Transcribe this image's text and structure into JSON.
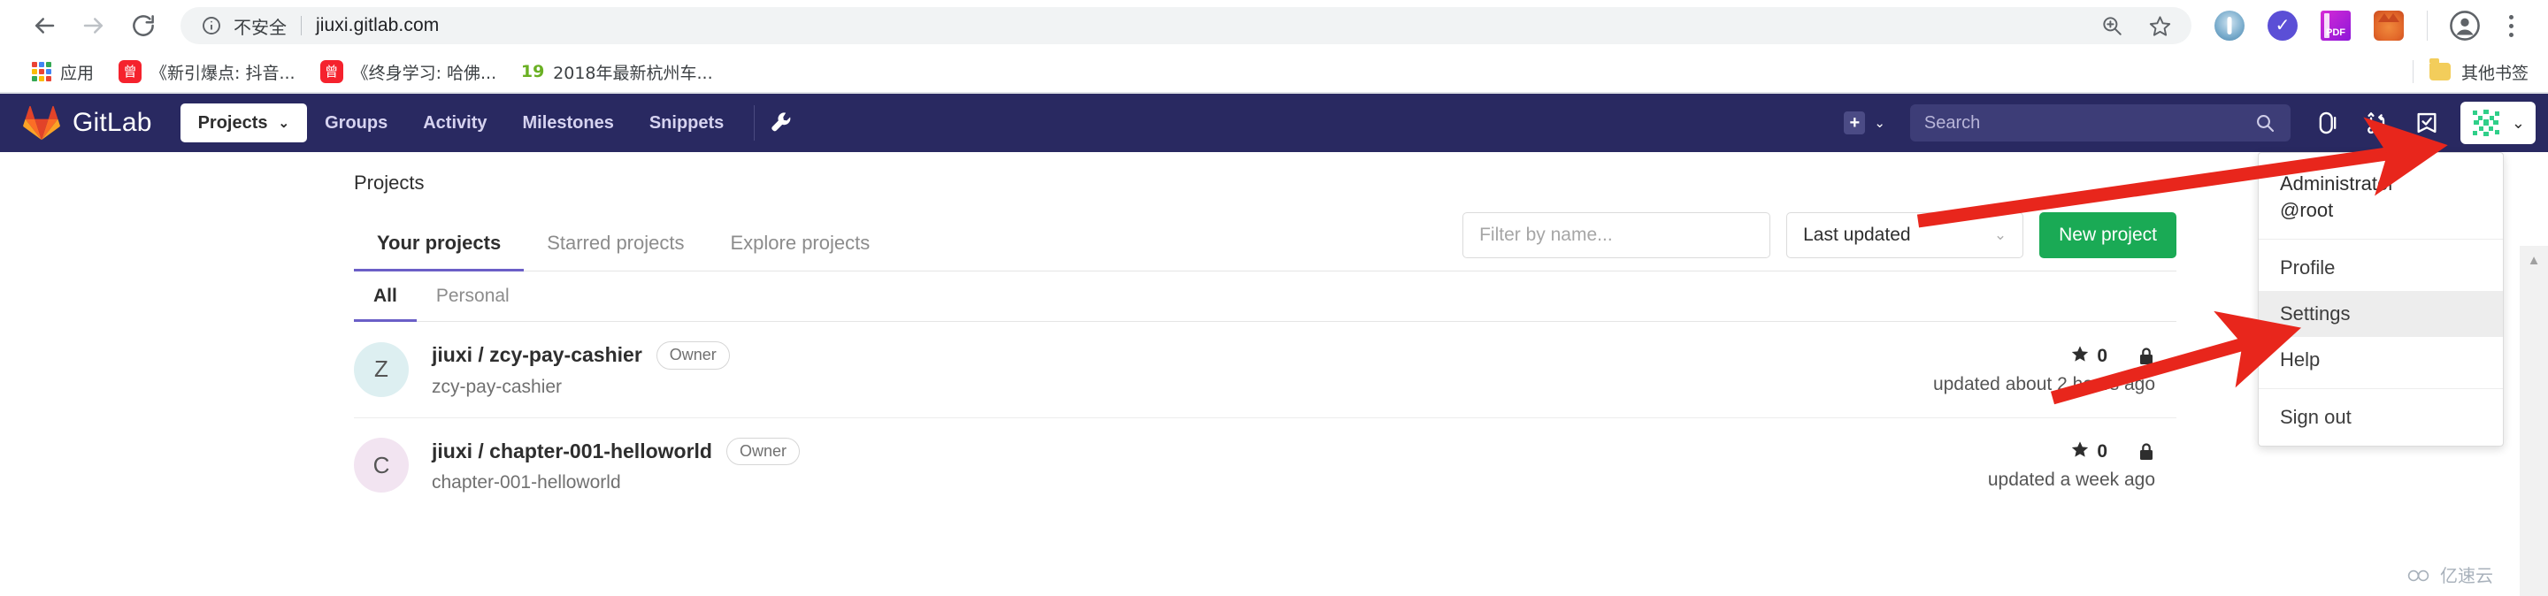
{
  "browser": {
    "nav": {
      "back_icon": "arrow-left-icon",
      "forward_icon": "arrow-right-icon",
      "reload_icon": "reload-icon"
    },
    "omnibox": {
      "info_icon": "info-circle-icon",
      "security_label": "不安全",
      "url": "jiuxi.gitlab.com",
      "zoom_icon": "zoom-in-icon",
      "bookmark_icon": "star-icon"
    },
    "extensions": [
      {
        "name": "brave-extension-icon",
        "title": ""
      },
      {
        "name": "verified-badge-extension-icon",
        "title": ""
      },
      {
        "name": "pdf-extension-icon",
        "title": "PDF"
      },
      {
        "name": "metamask-fox-extension-icon",
        "title": ""
      }
    ],
    "profile_icon": "account-circle-icon",
    "menu_icon": "three-dot-menu-icon",
    "bookmarks": [
      {
        "icon": "apps-grid-icon",
        "label": "应用"
      },
      {
        "icon": "red-square-icon",
        "label": "《新引爆点: 抖音..."
      },
      {
        "icon": "red-square-icon",
        "label": "《终身学习: 哈佛..."
      },
      {
        "icon": "green-19-icon",
        "label": "2018年最新杭州车..."
      }
    ],
    "other_bookmarks": {
      "icon": "folder-icon",
      "label": "其他书签"
    }
  },
  "gitlab": {
    "brand": "GitLab",
    "logo_icon": "gitlab-tanuki-logo",
    "nav_links": [
      {
        "label": "Projects",
        "active": true,
        "chevron": "⌄"
      },
      {
        "label": "Groups",
        "active": false
      },
      {
        "label": "Activity",
        "active": false
      },
      {
        "label": "Milestones",
        "active": false
      },
      {
        "label": "Snippets",
        "active": false
      }
    ],
    "admin_icon": "wrench-icon",
    "plus": {
      "icon": "plus-square-icon",
      "chevron": "⌄"
    },
    "search": {
      "placeholder": "Search",
      "icon": "search-icon"
    },
    "right_icons": [
      {
        "name": "issues-icon"
      },
      {
        "name": "merge-requests-icon"
      },
      {
        "name": "todos-icon"
      }
    ],
    "user": {
      "avatar_icon": "identicon-avatar",
      "chevron": "⌄"
    }
  },
  "dropdown": {
    "name": "Administrator",
    "handle": "@root",
    "items": [
      {
        "label": "Profile",
        "highlighted": false
      },
      {
        "label": "Settings",
        "highlighted": true
      },
      {
        "label": "Help",
        "highlighted": false
      },
      {
        "label": "Sign out",
        "highlighted": false
      }
    ]
  },
  "main": {
    "breadcrumb": "Projects",
    "tabs": [
      {
        "label": "Your projects",
        "active": true
      },
      {
        "label": "Starred projects",
        "active": false
      },
      {
        "label": "Explore projects",
        "active": false
      }
    ],
    "filter": {
      "placeholder": "Filter by name...",
      "value": ""
    },
    "sort": {
      "value": "Last updated",
      "chevron": "⌄"
    },
    "new_project_label": "New project",
    "subtabs": [
      {
        "label": "All",
        "active": true
      },
      {
        "label": "Personal",
        "active": false
      }
    ],
    "projects": [
      {
        "avatar_letter": "Z",
        "avatar_color": "#ddeff1",
        "title": "jiuxi / zcy-pay-cashier",
        "badge": "Owner",
        "description": "zcy-pay-cashier",
        "stars": "0",
        "star_icon": "star-filled-icon",
        "visibility_icon": "lock-icon",
        "updated": "updated about 2 hours ago"
      },
      {
        "avatar_letter": "C",
        "avatar_color": "#f2e4f1",
        "title": "jiuxi / chapter-001-helloworld",
        "badge": "Owner",
        "description": "chapter-001-helloworld",
        "stars": "0",
        "star_icon": "star-filled-icon",
        "visibility_icon": "lock-icon",
        "updated": "updated a week ago"
      }
    ]
  },
  "watermark": {
    "text": "亿速云",
    "icon": "cloud-icon"
  },
  "annotations": {
    "arrow_color": "#e8261c",
    "arrow_to_avatar": "points at the user avatar dropdown toggle",
    "arrow_to_settings": "points at the Settings menu item"
  },
  "colors": {
    "gitlab_navy": "#292961",
    "accent_purple": "#6b5fc7",
    "green_button": "#1aaa55",
    "arrow_red": "#e8261c"
  }
}
